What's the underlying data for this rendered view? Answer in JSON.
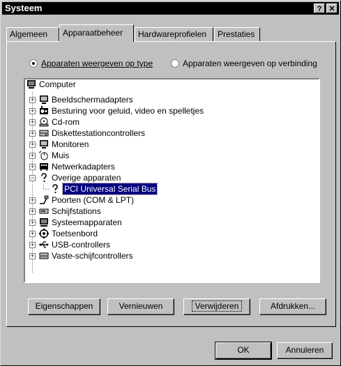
{
  "window": {
    "title": "Systeem",
    "help_button": "?",
    "close_button": "✕"
  },
  "tabs": [
    {
      "label": "Algemeen",
      "active": false
    },
    {
      "label": "Apparaatbeheer",
      "active": true
    },
    {
      "label": "Hardwareprofielen",
      "active": false
    },
    {
      "label": "Prestaties",
      "active": false
    }
  ],
  "view_options": {
    "by_type": {
      "label": "Apparaten weergeven op type",
      "selected": true
    },
    "by_connection": {
      "label": "Apparaten weergeven op verbinding",
      "selected": false
    }
  },
  "tree": {
    "root": "Computer",
    "items": [
      {
        "label": "Beeldschermadapters",
        "icon": "monitor-icon",
        "expanded": false
      },
      {
        "label": "Besturing voor geluid, video en spelletjes",
        "icon": "sound-icon",
        "expanded": false
      },
      {
        "label": "Cd-rom",
        "icon": "cdrom-icon",
        "expanded": false
      },
      {
        "label": "Diskettestationcontrollers",
        "icon": "floppy-controller-icon",
        "expanded": false
      },
      {
        "label": "Monitoren",
        "icon": "monitor-icon",
        "expanded": false
      },
      {
        "label": "Muis",
        "icon": "mouse-icon",
        "expanded": false
      },
      {
        "label": "Netwerkadapters",
        "icon": "network-icon",
        "expanded": false
      },
      {
        "label": "Overige apparaten",
        "icon": "question-icon",
        "expanded": true
      },
      {
        "label": "Poorten (COM & LPT)",
        "icon": "port-icon",
        "expanded": false
      },
      {
        "label": "Schijfstations",
        "icon": "disk-icon",
        "expanded": false
      },
      {
        "label": "Systeemapparaten",
        "icon": "system-icon",
        "expanded": false
      },
      {
        "label": "Toetsenbord",
        "icon": "keyboard-icon",
        "expanded": false
      },
      {
        "label": "USB-controllers",
        "icon": "usb-icon",
        "expanded": false
      },
      {
        "label": "Vaste-schijfcontrollers",
        "icon": "hdd-controller-icon",
        "expanded": false
      }
    ],
    "child_of_overige": {
      "label": "PCI Universal Serial Bus",
      "icon": "question-icon",
      "selected": true
    }
  },
  "buttons": {
    "properties": "Eigenschappen",
    "refresh": "Vernieuwen",
    "remove": "Verwijderen",
    "print": "Afdrukken...",
    "ok": "OK",
    "cancel": "Annuleren"
  }
}
